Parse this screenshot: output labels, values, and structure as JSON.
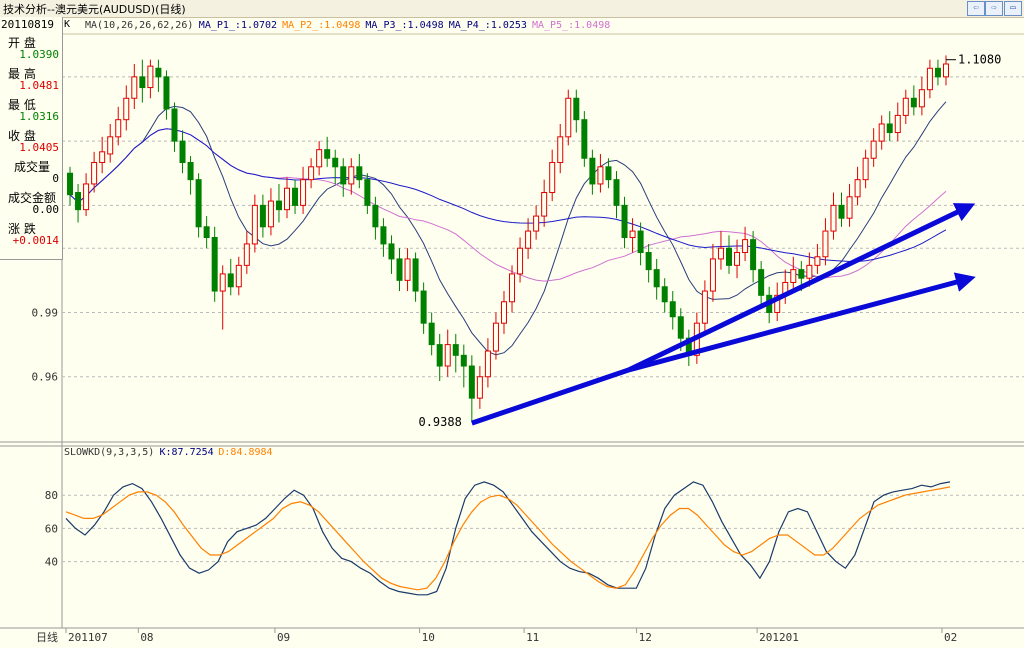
{
  "window": {
    "title": "技术分析--澳元美元(AUDUSD)(日线)",
    "buttons": [
      "⇦",
      "⇨",
      "▭",
      "▭"
    ]
  },
  "panel": {
    "date": "20110819",
    "k_label": "K",
    "rows": [
      {
        "label": "开  盘",
        "value": "1.0390",
        "color": "#008000"
      },
      {
        "label": "最  高",
        "value": "1.0481",
        "color": "#e00000"
      },
      {
        "label": "最  低",
        "value": "1.0316",
        "color": "#008000"
      },
      {
        "label": "收  盘",
        "value": "1.0405",
        "color": "#e00000"
      },
      {
        "label": "成交量",
        "value": "0",
        "color": "#000000"
      },
      {
        "label": "成交金额",
        "value": "0.00",
        "color": "#000000"
      },
      {
        "label": "涨  跌",
        "value": "+0.0014",
        "color": "#e00000"
      }
    ]
  },
  "ma_legend": [
    {
      "text": "MA(10,26,26,62,26)",
      "color": "#333333"
    },
    {
      "text": "MA_P1_:1.0702",
      "color": "#000080"
    },
    {
      "text": "MA_P2_:1.0498",
      "color": "#ff8000"
    },
    {
      "text": "MA_P3_:1.0498",
      "color": "#000080"
    },
    {
      "text": "MA_P4_:1.0253",
      "color": "#000080"
    },
    {
      "text": "MA_P5_:1.0498",
      "color": "#d070d0"
    }
  ],
  "kd_legend": [
    {
      "text": "SLOWKD(9,3,3,5)",
      "color": "#333333"
    },
    {
      "text": "K:87.7254",
      "color": "#000080"
    },
    {
      "text": "D:84.8984",
      "color": "#ff8000"
    }
  ],
  "price_axis": {
    "labels": [
      "0.99",
      "0.96"
    ]
  },
  "kd_axis": {
    "labels": [
      "80",
      "60",
      "40"
    ]
  },
  "annotations": {
    "high": "1.1080",
    "low": "0.9388"
  },
  "time_axis": {
    "corner": "日线",
    "labels": [
      "201107",
      "08",
      "09",
      "10",
      "11",
      "12",
      "201201",
      "02"
    ]
  },
  "chart_data": {
    "type": "candlestick",
    "title": "澳元美元(AUDUSD) 日线",
    "ylim": [
      0.93,
      1.12
    ],
    "kd_ylim": [
      0,
      100
    ],
    "colors": {
      "up": "#e00000",
      "down": "#008000",
      "ma1": "#2a3e7a",
      "ma2": "#d070d0",
      "ma3": "#1b1bc8",
      "k": "#1a3a6a",
      "d": "#ff8000",
      "arrow": "#0a0ad8"
    },
    "highlights": {
      "high": 1.108,
      "low": 0.9388
    },
    "candles": [
      [
        1.055,
        1.045,
        1.058,
        1.04
      ],
      [
        1.046,
        1.038,
        1.05,
        1.032
      ],
      [
        1.038,
        1.05,
        1.055,
        1.035
      ],
      [
        1.05,
        1.06,
        1.065,
        1.046
      ],
      [
        1.06,
        1.065,
        1.072,
        1.055
      ],
      [
        1.064,
        1.072,
        1.078,
        1.06
      ],
      [
        1.072,
        1.08,
        1.086,
        1.068
      ],
      [
        1.08,
        1.09,
        1.096,
        1.075
      ],
      [
        1.09,
        1.1,
        1.106,
        1.085
      ],
      [
        1.1,
        1.095,
        1.108,
        1.088
      ],
      [
        1.095,
        1.105,
        1.108,
        1.09
      ],
      [
        1.104,
        1.1,
        1.108,
        1.093
      ],
      [
        1.1,
        1.085,
        1.103,
        1.08
      ],
      [
        1.085,
        1.07,
        1.088,
        1.065
      ],
      [
        1.07,
        1.06,
        1.075,
        1.055
      ],
      [
        1.06,
        1.052,
        1.063,
        1.045
      ],
      [
        1.052,
        1.03,
        1.055,
        1.025
      ],
      [
        1.03,
        1.025,
        1.035,
        1.02
      ],
      [
        1.025,
        1.0,
        1.03,
        0.995
      ],
      [
        1.0,
        1.008,
        1.012,
        0.982
      ],
      [
        1.008,
        1.002,
        1.015,
        0.998
      ],
      [
        1.002,
        1.012,
        1.016,
        0.998
      ],
      [
        1.012,
        1.022,
        1.028,
        1.008
      ],
      [
        1.022,
        1.04,
        1.045,
        1.018
      ],
      [
        1.04,
        1.03,
        1.045,
        1.025
      ],
      [
        1.03,
        1.042,
        1.048,
        1.026
      ],
      [
        1.042,
        1.038,
        1.05,
        1.032
      ],
      [
        1.038,
        1.048,
        1.053,
        1.034
      ],
      [
        1.048,
        1.04,
        1.052,
        1.036
      ],
      [
        1.04,
        1.052,
        1.058,
        1.036
      ],
      [
        1.052,
        1.058,
        1.062,
        1.048
      ],
      [
        1.058,
        1.066,
        1.07,
        1.054
      ],
      [
        1.066,
        1.062,
        1.072,
        1.058
      ],
      [
        1.062,
        1.058,
        1.066,
        1.05
      ],
      [
        1.058,
        1.05,
        1.062,
        1.044
      ],
      [
        1.05,
        1.058,
        1.062,
        1.045
      ],
      [
        1.058,
        1.052,
        1.064,
        1.048
      ],
      [
        1.052,
        1.04,
        1.055,
        1.036
      ],
      [
        1.04,
        1.03,
        1.044,
        1.024
      ],
      [
        1.03,
        1.022,
        1.034,
        1.016
      ],
      [
        1.022,
        1.015,
        1.026,
        1.008
      ],
      [
        1.015,
        1.005,
        1.02,
        1.0
      ],
      [
        1.005,
        1.015,
        1.02,
        1.0
      ],
      [
        1.015,
        1.0,
        1.018,
        0.995
      ],
      [
        1.0,
        0.985,
        1.004,
        0.98
      ],
      [
        0.985,
        0.975,
        0.99,
        0.97
      ],
      [
        0.975,
        0.965,
        0.98,
        0.958
      ],
      [
        0.965,
        0.975,
        0.982,
        0.96
      ],
      [
        0.975,
        0.97,
        0.98,
        0.962
      ],
      [
        0.97,
        0.965,
        0.975,
        0.955
      ],
      [
        0.965,
        0.95,
        0.97,
        0.9388
      ],
      [
        0.95,
        0.96,
        0.965,
        0.945
      ],
      [
        0.96,
        0.972,
        0.978,
        0.955
      ],
      [
        0.972,
        0.985,
        0.99,
        0.968
      ],
      [
        0.985,
        0.995,
        1.0,
        0.98
      ],
      [
        0.995,
        1.008,
        1.012,
        0.99
      ],
      [
        1.008,
        1.02,
        1.025,
        1.004
      ],
      [
        1.02,
        1.028,
        1.034,
        1.015
      ],
      [
        1.028,
        1.035,
        1.04,
        1.024
      ],
      [
        1.035,
        1.046,
        1.052,
        1.03
      ],
      [
        1.046,
        1.06,
        1.066,
        1.042
      ],
      [
        1.06,
        1.072,
        1.078,
        1.055
      ],
      [
        1.072,
        1.09,
        1.094,
        1.068
      ],
      [
        1.09,
        1.08,
        1.094,
        1.074
      ],
      [
        1.08,
        1.062,
        1.084,
        1.058
      ],
      [
        1.062,
        1.05,
        1.066,
        1.045
      ],
      [
        1.05,
        1.058,
        1.064,
        1.046
      ],
      [
        1.058,
        1.052,
        1.062,
        1.048
      ],
      [
        1.052,
        1.04,
        1.056,
        1.034
      ],
      [
        1.04,
        1.025,
        1.044,
        1.02
      ],
      [
        1.025,
        1.028,
        1.034,
        1.018
      ],
      [
        1.028,
        1.018,
        1.032,
        1.012
      ],
      [
        1.018,
        1.01,
        1.022,
        1.004
      ],
      [
        1.01,
        1.002,
        1.015,
        0.996
      ],
      [
        1.002,
        0.995,
        1.006,
        0.99
      ],
      [
        0.995,
        0.988,
        1.0,
        0.982
      ],
      [
        0.988,
        0.978,
        0.992,
        0.972
      ],
      [
        0.978,
        0.97,
        0.982,
        0.965
      ],
      [
        0.97,
        0.985,
        0.99,
        0.966
      ],
      [
        0.985,
        1.0,
        1.005,
        0.98
      ],
      [
        1.0,
        1.015,
        1.022,
        0.995
      ],
      [
        1.015,
        1.02,
        1.028,
        1.01
      ],
      [
        1.02,
        1.012,
        1.026,
        1.008
      ],
      [
        1.012,
        1.018,
        1.024,
        1.006
      ],
      [
        1.018,
        1.024,
        1.03,
        1.014
      ],
      [
        1.024,
        1.01,
        1.028,
        1.004
      ],
      [
        1.01,
        0.998,
        1.014,
        0.992
      ],
      [
        0.998,
        0.99,
        1.002,
        0.985
      ],
      [
        0.99,
        0.998,
        1.004,
        0.986
      ],
      [
        0.998,
        1.004,
        1.01,
        0.994
      ],
      [
        1.004,
        1.01,
        1.016,
        1.0
      ],
      [
        1.01,
        1.006,
        1.014,
        1.0
      ],
      [
        1.006,
        1.012,
        1.018,
        1.002
      ],
      [
        1.012,
        1.016,
        1.022,
        1.008
      ],
      [
        1.016,
        1.028,
        1.034,
        1.012
      ],
      [
        1.028,
        1.04,
        1.046,
        1.024
      ],
      [
        1.04,
        1.034,
        1.046,
        1.03
      ],
      [
        1.034,
        1.044,
        1.05,
        1.03
      ],
      [
        1.044,
        1.052,
        1.058,
        1.04
      ],
      [
        1.052,
        1.062,
        1.066,
        1.048
      ],
      [
        1.062,
        1.07,
        1.076,
        1.058
      ],
      [
        1.07,
        1.078,
        1.082,
        1.066
      ],
      [
        1.078,
        1.074,
        1.084,
        1.07
      ],
      [
        1.074,
        1.082,
        1.088,
        1.07
      ],
      [
        1.082,
        1.09,
        1.094,
        1.078
      ],
      [
        1.09,
        1.086,
        1.096,
        1.082
      ],
      [
        1.086,
        1.094,
        1.1,
        1.082
      ],
      [
        1.094,
        1.104,
        1.108,
        1.09
      ],
      [
        1.104,
        1.1,
        1.108,
        1.096
      ],
      [
        1.1,
        1.106,
        1.11,
        1.096
      ]
    ],
    "kd_series": [
      {
        "name": "K",
        "values": [
          66,
          60,
          56,
          62,
          70,
          80,
          85,
          87,
          84,
          76,
          66,
          55,
          44,
          36,
          33,
          35,
          40,
          52,
          58,
          60,
          62,
          66,
          72,
          78,
          83,
          80,
          72,
          58,
          48,
          42,
          40,
          36,
          33,
          28,
          24,
          22,
          21,
          20,
          20,
          22,
          36,
          60,
          78,
          86,
          88,
          86,
          82,
          74,
          66,
          58,
          52,
          46,
          40,
          36,
          34,
          33,
          30,
          26,
          24,
          24,
          24,
          36,
          56,
          72,
          80,
          84,
          88,
          86,
          76,
          64,
          54,
          44,
          38,
          30,
          40,
          58,
          70,
          72,
          70,
          58,
          46,
          40,
          36,
          44,
          60,
          76,
          80,
          82,
          83,
          84,
          86,
          85,
          87,
          88
        ]
      },
      {
        "name": "D",
        "values": [
          70,
          68,
          66,
          66,
          68,
          72,
          76,
          80,
          82,
          82,
          80,
          76,
          70,
          62,
          55,
          48,
          44,
          44,
          46,
          50,
          54,
          58,
          62,
          66,
          72,
          75,
          76,
          74,
          70,
          64,
          58,
          52,
          46,
          40,
          35,
          30,
          27,
          25,
          24,
          23,
          24,
          30,
          40,
          52,
          62,
          70,
          76,
          79,
          80,
          78,
          74,
          68,
          62,
          56,
          50,
          45,
          40,
          36,
          32,
          28,
          25,
          24,
          26,
          34,
          44,
          54,
          62,
          68,
          72,
          72,
          68,
          62,
          56,
          50,
          46,
          44,
          46,
          50,
          54,
          56,
          56,
          52,
          48,
          44,
          44,
          48,
          54,
          60,
          66,
          70,
          74,
          76,
          78,
          80,
          81,
          82,
          83,
          84,
          85
        ]
      }
    ]
  }
}
